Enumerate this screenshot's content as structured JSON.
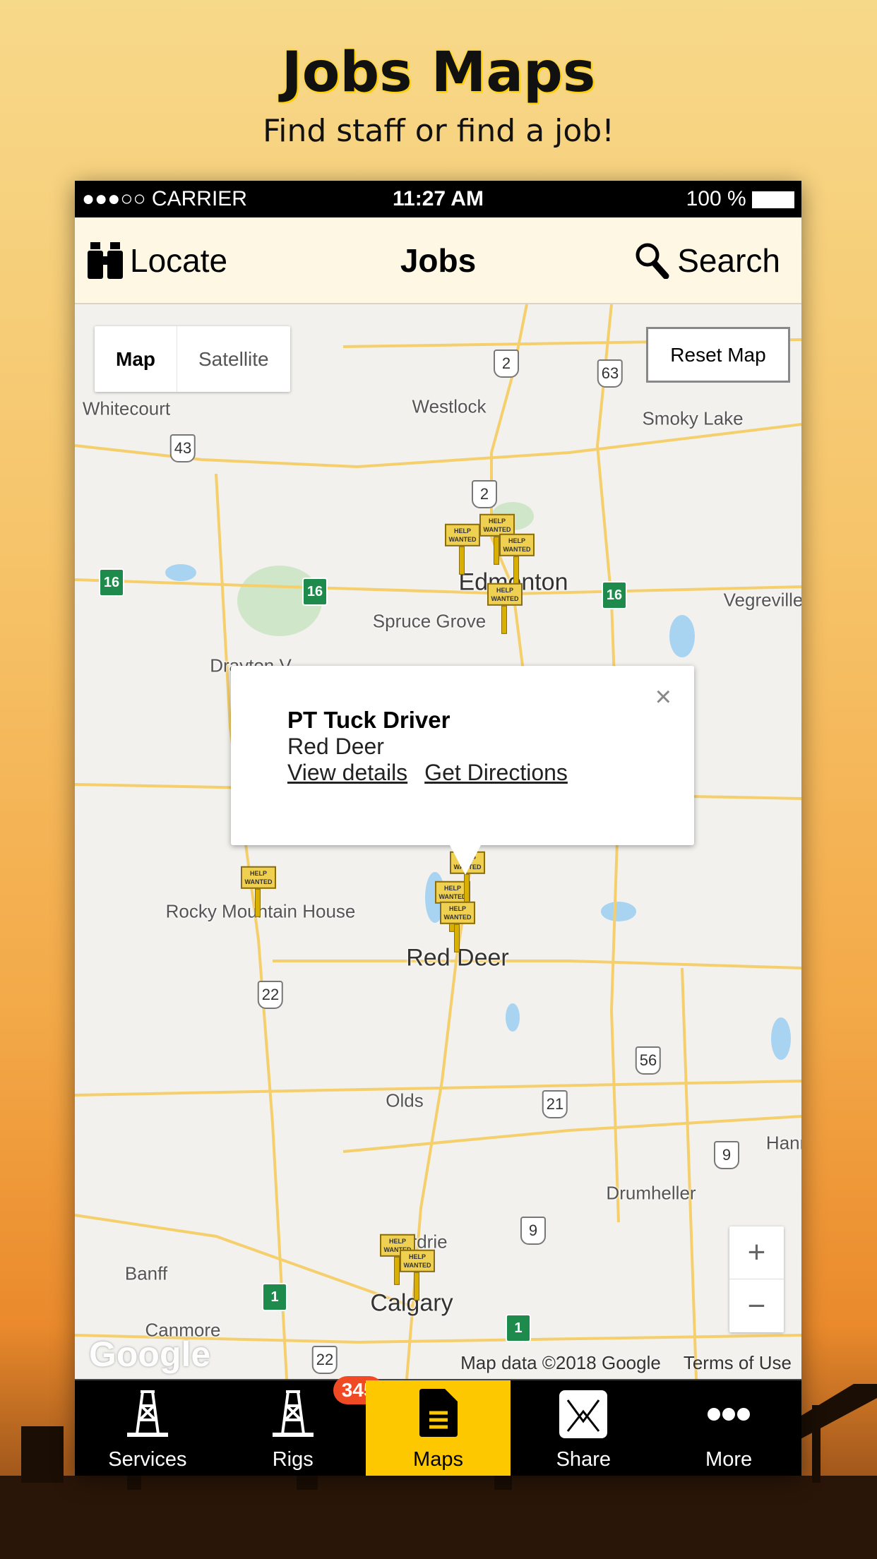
{
  "promo": {
    "title": "Jobs Maps",
    "subtitle": "Find staff or find a job!"
  },
  "status": {
    "carrier": "●●●○○ CARRIER",
    "time": "11:27 AM",
    "battery": "100 %"
  },
  "header": {
    "locate": "Locate",
    "title": "Jobs",
    "search": "Search"
  },
  "map": {
    "type_control": {
      "map": "Map",
      "satellite": "Satellite"
    },
    "reset": "Reset Map",
    "cities": [
      "Whitecourt",
      "Westlock",
      "Smoky Lake",
      "Edmonton",
      "Spruce Grove",
      "Vegreville",
      "Drayton V",
      "Rocky Mountain House",
      "Red Deer",
      "Olds",
      "Drumheller",
      "Airdrie",
      "Banff",
      "Canmore",
      "Calgary",
      "Hann"
    ],
    "shields": [
      "2",
      "63",
      "43",
      "2",
      "16",
      "16",
      "16",
      "22",
      "56",
      "21",
      "9",
      "9",
      "1",
      "1",
      "22"
    ],
    "marker_label": "HELP WANTED",
    "popup": {
      "title": "PT Tuck Driver",
      "location": "Red Deer",
      "view": "View details",
      "directions": "Get Directions",
      "close": "×"
    },
    "zoom_in": "+",
    "zoom_out": "−",
    "logo": "Google",
    "attribution": "Map data ©2018 Google",
    "terms": "Terms of Use"
  },
  "tabs": [
    {
      "label": "Services"
    },
    {
      "label": "Rigs",
      "badge": "345"
    },
    {
      "label": "Maps",
      "active": true
    },
    {
      "label": "Share"
    },
    {
      "label": "More"
    }
  ],
  "colors": {
    "accent": "#fdc800",
    "badge": "#f04a25",
    "header_bg": "#fdf7e3"
  }
}
